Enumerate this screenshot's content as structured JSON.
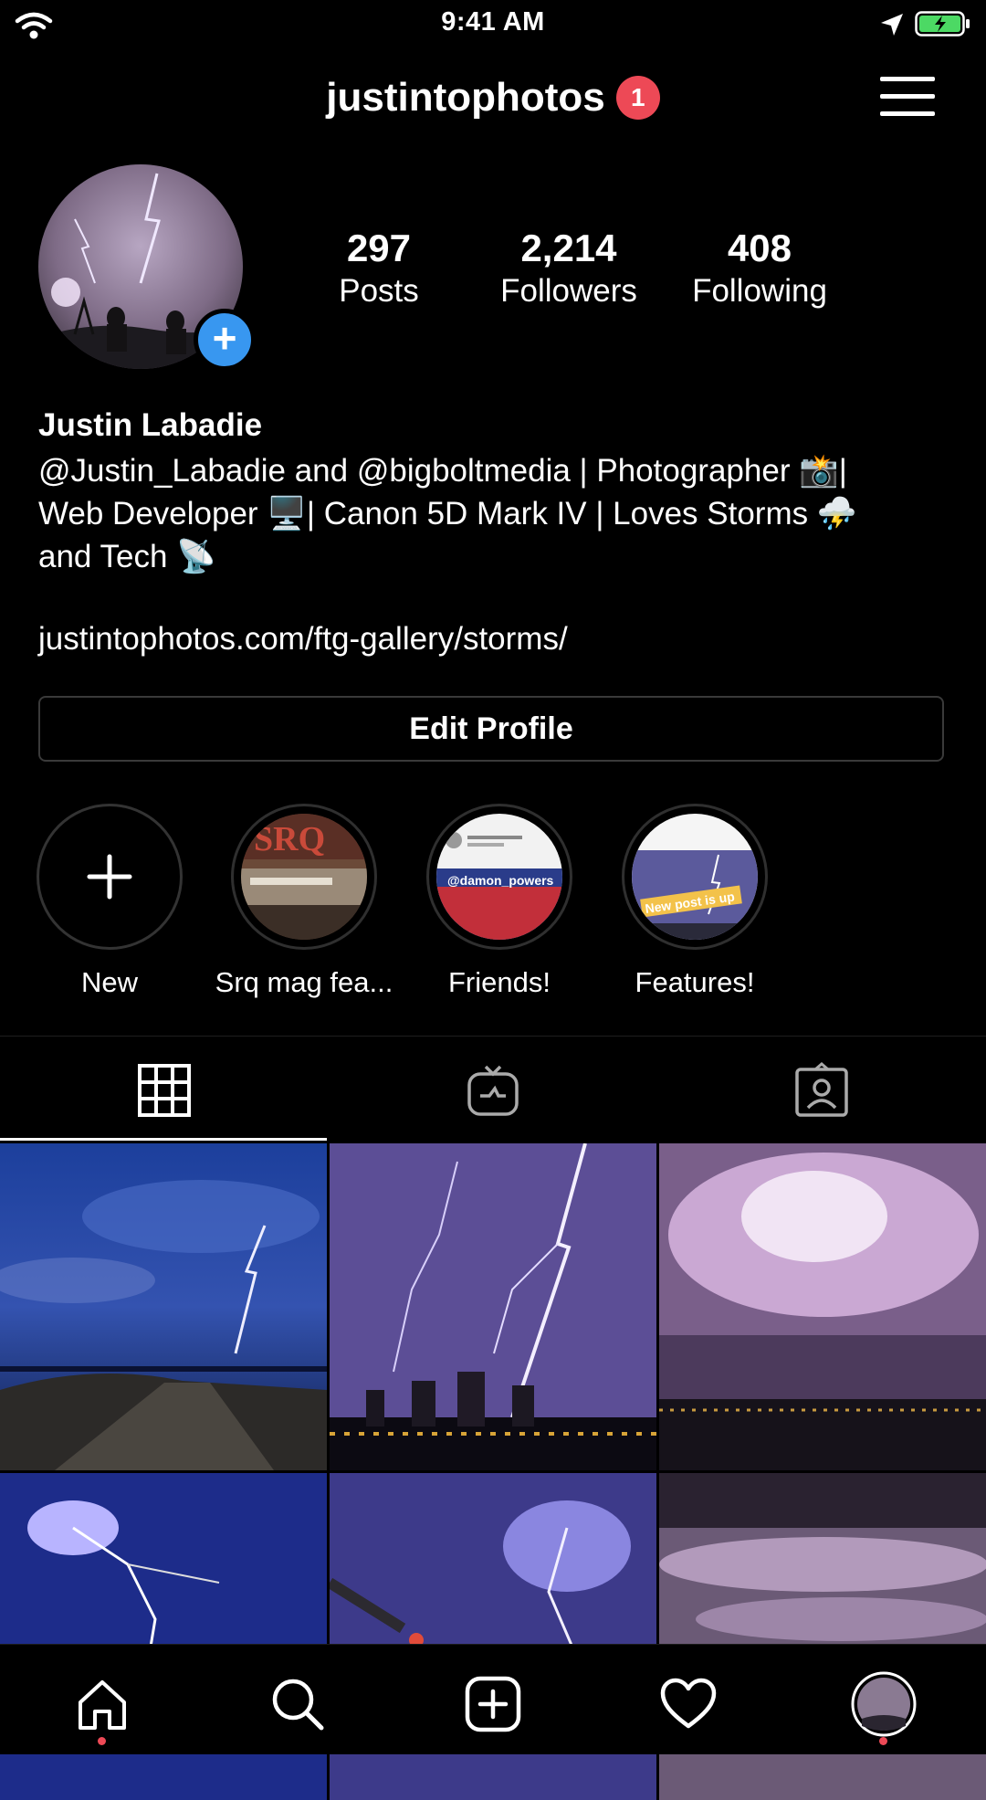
{
  "status_bar": {
    "time": "9:41 AM"
  },
  "header": {
    "username": "justintophotos",
    "notification_count": "1"
  },
  "profile": {
    "stats": [
      {
        "value": "297",
        "label": "Posts"
      },
      {
        "value": "2,214",
        "label": "Followers"
      },
      {
        "value": "408",
        "label": "Following"
      }
    ],
    "name": "Justin Labadie",
    "bio_line1": "@Justin_Labadie and @bigboltmedia | Photographer 📸|",
    "bio_line2": "Web Developer 🖥️| Canon 5D Mark IV | Loves Storms ⛈️",
    "bio_line3": "and Tech 📡",
    "link": "justintophotos.com/ftg-gallery/storms/",
    "edit_button": "Edit Profile"
  },
  "highlights": [
    {
      "label": "New"
    },
    {
      "label": "Srq mag fea..."
    },
    {
      "label": "Friends!"
    },
    {
      "label": "Features!"
    }
  ],
  "highlight_overlays": {
    "srq": "SRQ",
    "friends_tag": "@damon_powers",
    "features_banner": "New post is up"
  },
  "tabs": [
    {
      "icon": "grid-icon",
      "active": true
    },
    {
      "icon": "igtv-icon",
      "active": false
    },
    {
      "icon": "tagged-icon",
      "active": false
    }
  ],
  "colors": {
    "accent_blue": "#3897f0",
    "badge_red": "#ed4956",
    "battery_green": "#4cd964"
  },
  "bottom_nav": [
    "home-icon",
    "search-icon",
    "add-post-icon",
    "heart-icon",
    "profile-avatar"
  ]
}
